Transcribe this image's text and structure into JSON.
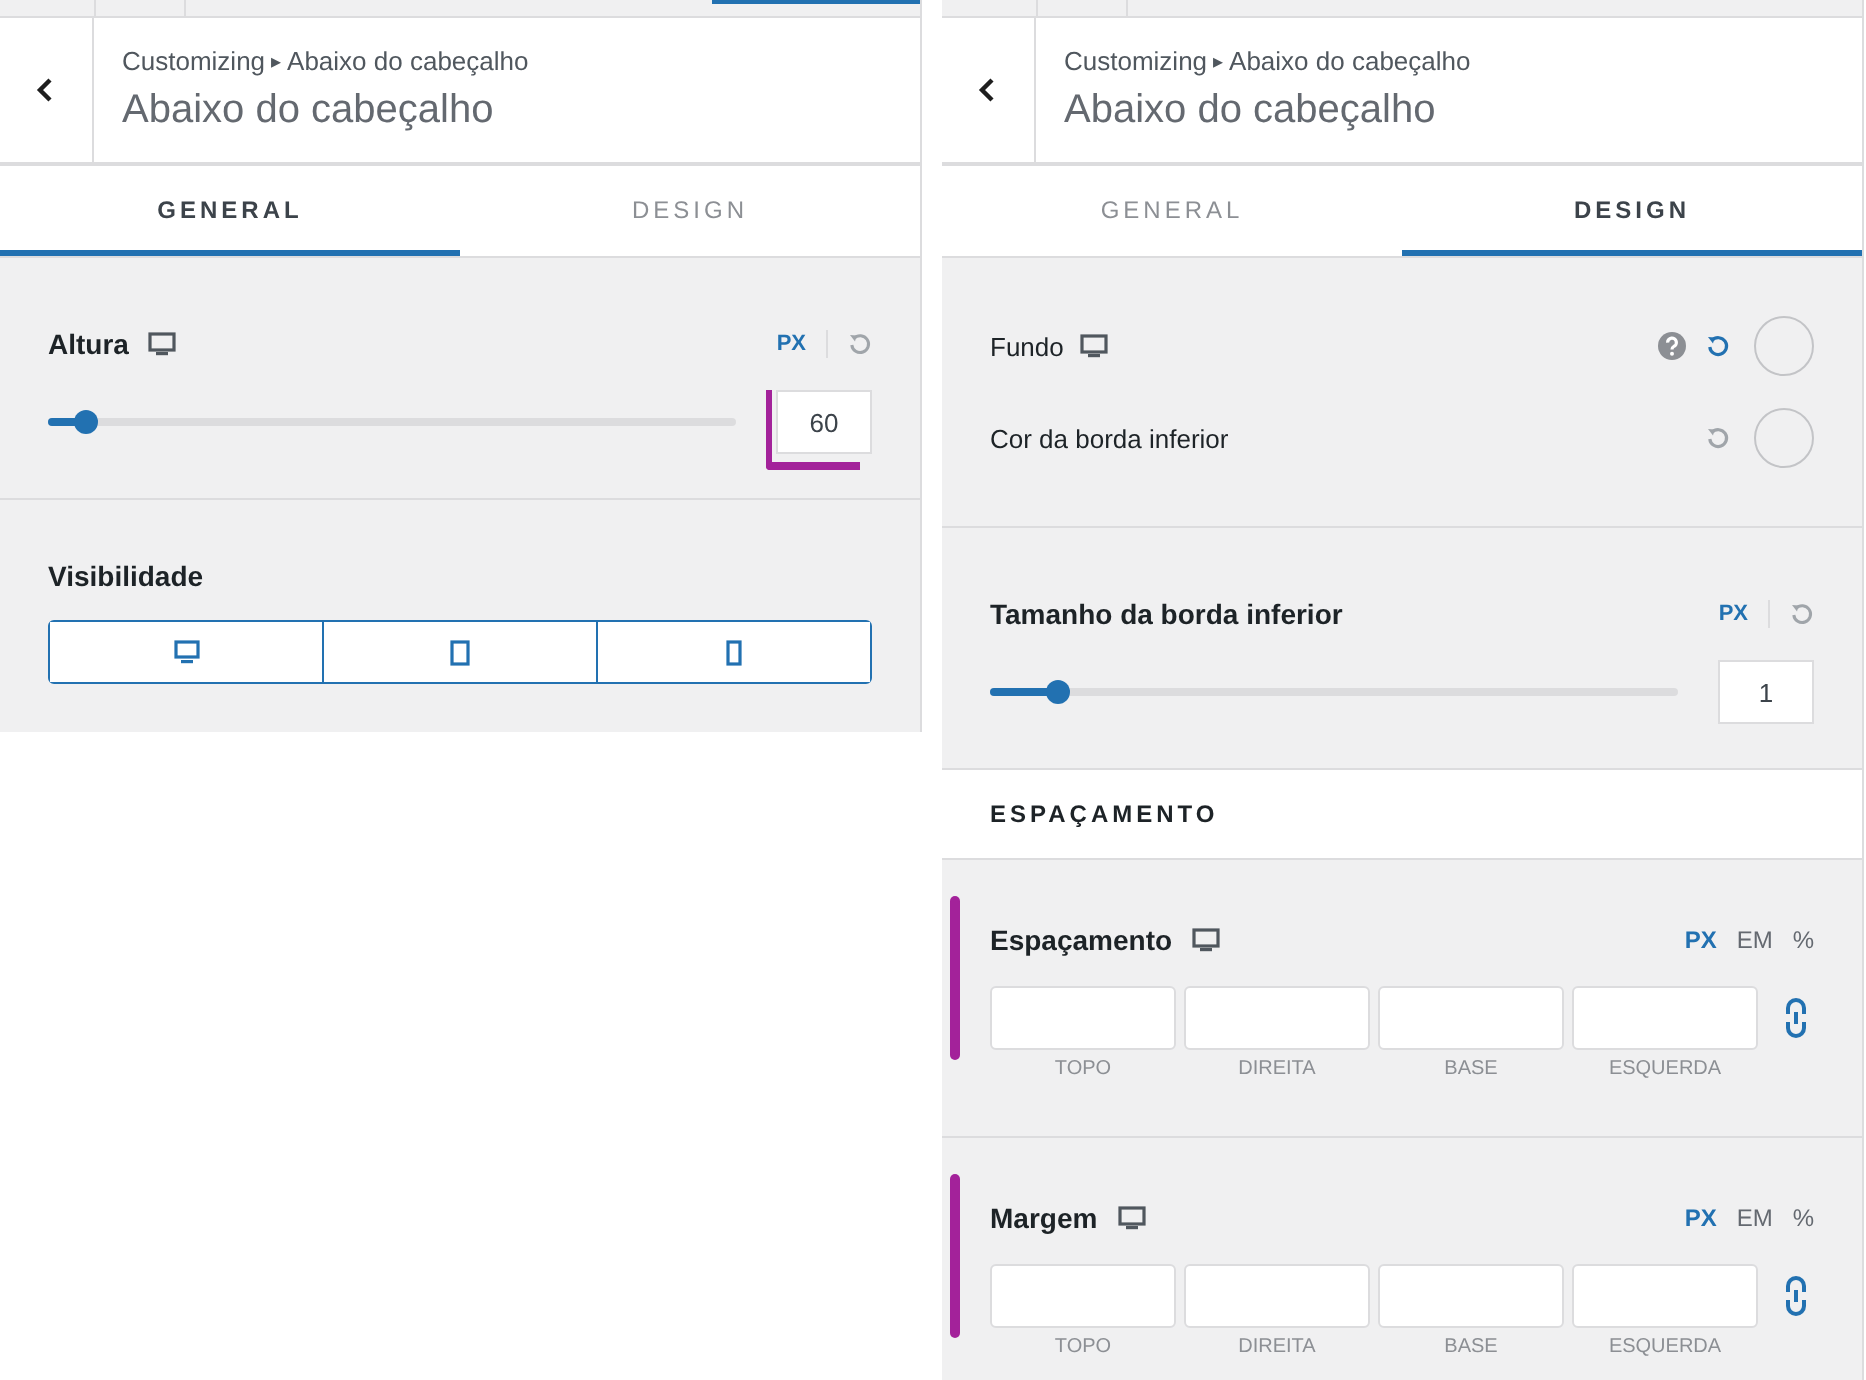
{
  "panels": [
    {
      "header": {
        "parent": "Customizing",
        "separator": "▸",
        "current": "Abaixo do cabeçalho",
        "title": "Abaixo do cabeçalho"
      },
      "tabs": [
        {
          "label": "GENERAL",
          "selected": true
        },
        {
          "label": "DESIGN",
          "selected": false
        }
      ],
      "sections": [
        {
          "kind": "slider",
          "label": "Altura",
          "responsive": true,
          "units": [
            {
              "label": "PX",
              "selected": true
            }
          ],
          "level": 0.055,
          "value": "60",
          "highlighted": true
        },
        {
          "kind": "visibility",
          "label": "Visibilidade",
          "devices": [
            {
              "kind": "desktop"
            },
            {
              "kind": "tablet"
            },
            {
              "kind": "mobile"
            }
          ]
        }
      ]
    },
    {
      "header": {
        "parent": "Customizing",
        "separator": "▸",
        "current": "Abaixo do cabeçalho",
        "title": "Abaixo do cabeçalho"
      },
      "tabs": [
        {
          "label": "GENERAL",
          "selected": false
        },
        {
          "label": "DESIGN",
          "selected": true
        }
      ],
      "sections": [
        {
          "kind": "colors",
          "rows": [
            {
              "label": "Fundo",
              "responsive": true,
              "help": true,
              "reset_active": true
            },
            {
              "label": "Cor da borda inferior",
              "responsive": false,
              "help": false,
              "reset_active": false
            }
          ]
        },
        {
          "kind": "slider",
          "label": "Tamanho da borda inferior",
          "responsive": false,
          "units": [
            {
              "label": "PX",
              "selected": true
            }
          ],
          "level": 0.1,
          "value": "1",
          "highlighted": false
        },
        {
          "kind": "heading",
          "label": "ESPAÇAMENTO"
        },
        {
          "kind": "spacing",
          "label": "Espaçamento",
          "responsive": true,
          "units": [
            {
              "label": "PX",
              "selected": true
            },
            {
              "label": "EM",
              "selected": false
            },
            {
              "label": "%",
              "selected": false
            }
          ],
          "sides": [
            "TOPO",
            "DIREITA",
            "BASE",
            "ESQUERDA"
          ],
          "highlighted": true
        },
        {
          "kind": "spacing",
          "label": "Margem",
          "responsive": true,
          "units": [
            {
              "label": "PX",
              "selected": true
            },
            {
              "label": "EM",
              "selected": false
            },
            {
              "label": "%",
              "selected": false
            }
          ],
          "sides": [
            "TOPO",
            "DIREITA",
            "BASE",
            "ESQUERDA"
          ],
          "highlighted": true
        }
      ]
    }
  ]
}
